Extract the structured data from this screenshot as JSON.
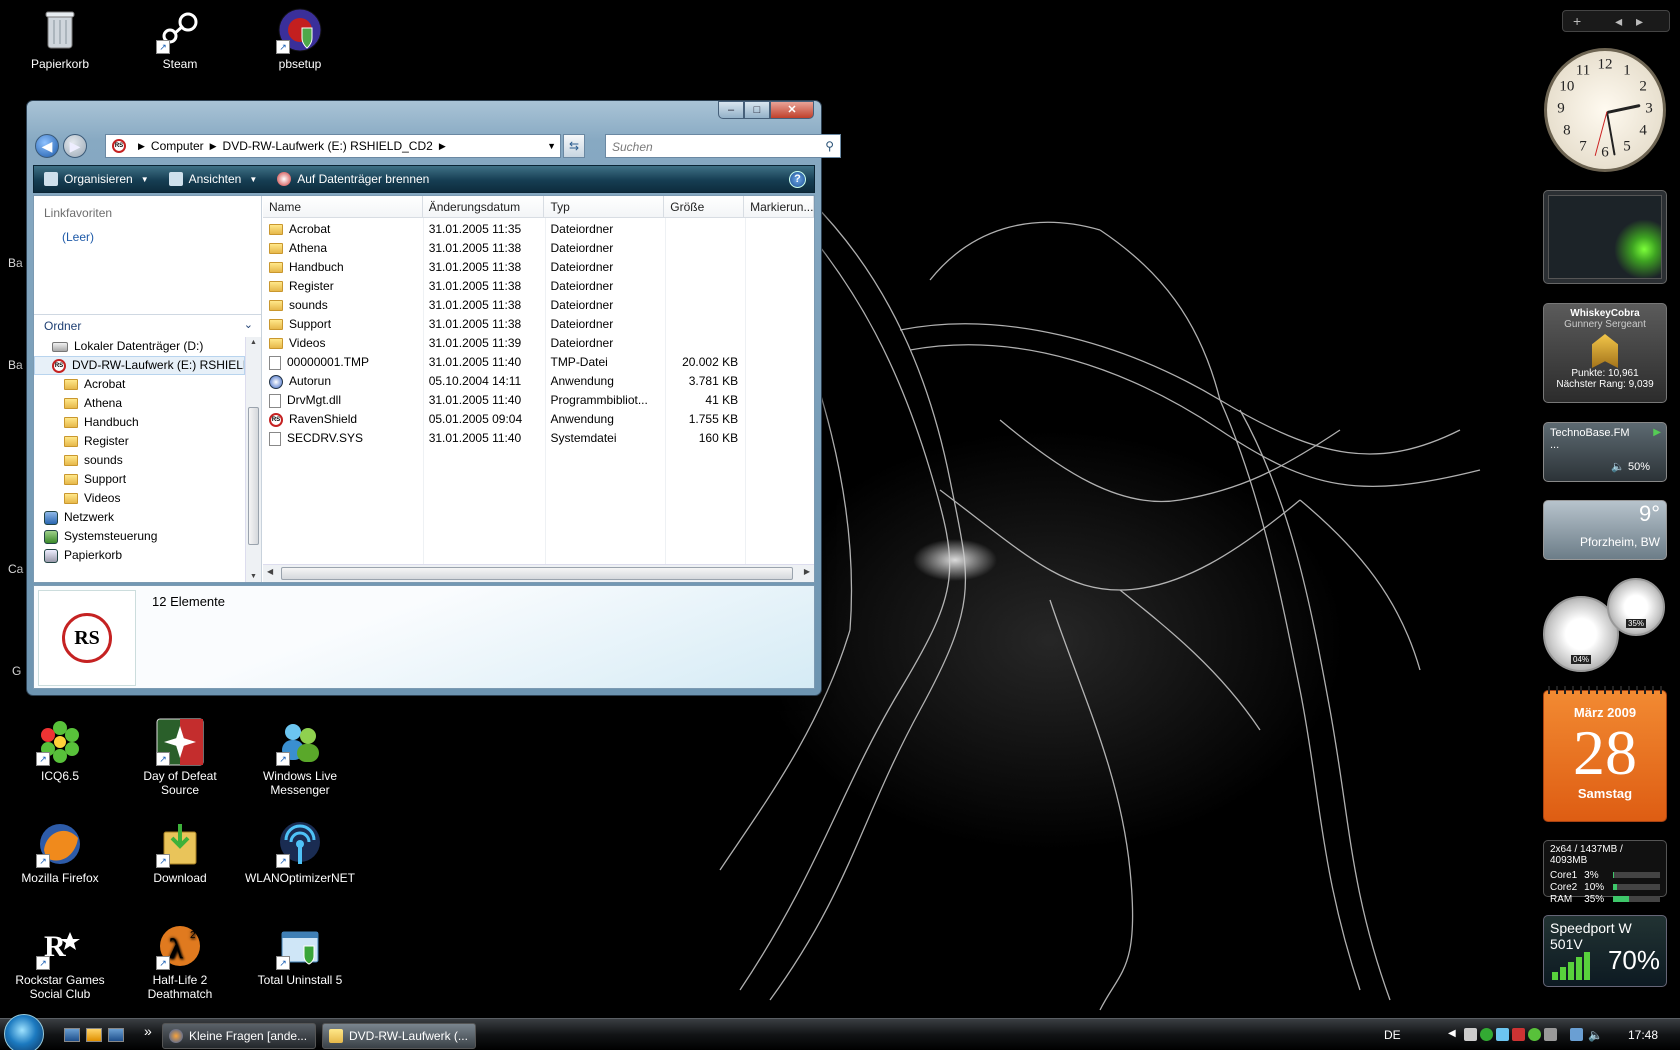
{
  "desktop": {
    "icons_top": [
      {
        "label": "Papierkorb",
        "icon": "recycle-bin-icon"
      },
      {
        "label": "Steam",
        "icon": "steam-icon"
      },
      {
        "label": "pbsetup",
        "icon": "pbsetup-icon"
      }
    ],
    "left_edge_fragments": [
      "Ba",
      "Ba",
      "Ca",
      "G"
    ],
    "icons_bottom": [
      {
        "label": "ICQ6.5",
        "icon": "icq-icon"
      },
      {
        "label": "Day of Defeat Source",
        "icon": "day-of-defeat-icon"
      },
      {
        "label": "Windows Live Messenger",
        "icon": "messenger-icon"
      },
      {
        "label": "Mozilla Firefox",
        "icon": "firefox-icon"
      },
      {
        "label": "Download",
        "icon": "download-folder-icon"
      },
      {
        "label": "WLANOptimizerNET",
        "icon": "wlan-optimizer-icon"
      },
      {
        "label": "Rockstar Games Social Club",
        "icon": "rockstar-icon"
      },
      {
        "label": "Half-Life 2 Deathmatch",
        "icon": "half-life-icon"
      },
      {
        "label": "Total Uninstall 5",
        "icon": "uninstall-icon"
      }
    ]
  },
  "explorer": {
    "caption_buttons": {
      "minimize": "–",
      "maximize": "□",
      "close": "✕"
    },
    "breadcrumb": [
      "Computer",
      "DVD-RW-Laufwerk (E:) RSHIELD_CD2"
    ],
    "search_placeholder": "Suchen",
    "toolbar": {
      "organize": "Organisieren",
      "views": "Ansichten",
      "burn": "Auf Datenträger brennen"
    },
    "nav": {
      "favorites_title": "Linkfavoriten",
      "favorites_empty": "(Leer)",
      "folders_title": "Ordner",
      "tree": [
        {
          "label": "Lokaler Datenträger (D:)",
          "icon": "drive-icon",
          "level": 1
        },
        {
          "label": "DVD-RW-Laufwerk (E:) RSHIELD_CD2",
          "icon": "dvd-drive-icon",
          "level": 1,
          "selected": true
        },
        {
          "label": "Acrobat",
          "icon": "folder-icon",
          "level": 2
        },
        {
          "label": "Athena",
          "icon": "folder-icon",
          "level": 2
        },
        {
          "label": "Handbuch",
          "icon": "folder-icon",
          "level": 2
        },
        {
          "label": "Register",
          "icon": "folder-icon",
          "level": 2
        },
        {
          "label": "sounds",
          "icon": "folder-icon",
          "level": 2
        },
        {
          "label": "Support",
          "icon": "folder-icon",
          "level": 2
        },
        {
          "label": "Videos",
          "icon": "folder-icon",
          "level": 2
        },
        {
          "label": "Netzwerk",
          "icon": "network-icon",
          "level": 0
        },
        {
          "label": "Systemsteuerung",
          "icon": "control-panel-icon",
          "level": 0
        },
        {
          "label": "Papierkorb",
          "icon": "recycle-bin-icon",
          "level": 0
        }
      ]
    },
    "columns": [
      "Name",
      "Änderungsdatum",
      "Typ",
      "Größe",
      "Markierun..."
    ],
    "files": [
      {
        "name": "Acrobat",
        "date": "31.01.2005 11:35",
        "type": "Dateiordner",
        "size": "",
        "icon": "folder-icon"
      },
      {
        "name": "Athena",
        "date": "31.01.2005 11:38",
        "type": "Dateiordner",
        "size": "",
        "icon": "folder-icon"
      },
      {
        "name": "Handbuch",
        "date": "31.01.2005 11:38",
        "type": "Dateiordner",
        "size": "",
        "icon": "folder-icon"
      },
      {
        "name": "Register",
        "date": "31.01.2005 11:38",
        "type": "Dateiordner",
        "size": "",
        "icon": "folder-icon"
      },
      {
        "name": "sounds",
        "date": "31.01.2005 11:38",
        "type": "Dateiordner",
        "size": "",
        "icon": "folder-icon"
      },
      {
        "name": "Support",
        "date": "31.01.2005 11:38",
        "type": "Dateiordner",
        "size": "",
        "icon": "folder-icon"
      },
      {
        "name": "Videos",
        "date": "31.01.2005 11:39",
        "type": "Dateiordner",
        "size": "",
        "icon": "folder-icon"
      },
      {
        "name": "00000001.TMP",
        "date": "31.01.2005 11:40",
        "type": "TMP-Datei",
        "size": "20.002 KB",
        "icon": "file-icon"
      },
      {
        "name": "Autorun",
        "date": "05.10.2004 14:11",
        "type": "Anwendung",
        "size": "3.781 KB",
        "icon": "app-icon"
      },
      {
        "name": "DrvMgt.dll",
        "date": "31.01.2005 11:40",
        "type": "Programmbibliot...",
        "size": "41 KB",
        "icon": "dll-icon"
      },
      {
        "name": "RavenShield",
        "date": "05.01.2005 09:04",
        "type": "Anwendung",
        "size": "1.755 KB",
        "icon": "ravenshield-icon"
      },
      {
        "name": "SECDRV.SYS",
        "date": "31.01.2005 11:40",
        "type": "Systemdatei",
        "size": "160 KB",
        "icon": "sys-file-icon"
      }
    ],
    "details": {
      "count": "12 Elemente",
      "logo_text": "RS"
    }
  },
  "gadgets": {
    "sidebar_controls": {
      "add": "+",
      "prev": "◂",
      "next": "▸"
    },
    "clock": {
      "numerals": [
        "12",
        "1",
        "2",
        "3",
        "4",
        "5",
        "6",
        "7",
        "8",
        "9",
        "10",
        "11"
      ]
    },
    "rank": {
      "name": "WhiskeyCobra",
      "rank": "Gunnery Sergeant",
      "points": "Punkte: 10,961",
      "next": "Nächster Rang: 9,039"
    },
    "radio": {
      "station": "TechnoBase.FM",
      "status": "...",
      "volume": "50%"
    },
    "weather": {
      "temp": "9°",
      "city": "Pforzheim, BW"
    },
    "meters": {
      "cpu": "04%",
      "ram": "35%"
    },
    "calendar": {
      "month": "März 2009",
      "day": "28",
      "weekday": "Samstag"
    },
    "sysmon": {
      "header": "2x64 / 1437MB / 4093MB",
      "rows": [
        {
          "label": "Core1",
          "value": "3%",
          "level": 0.03
        },
        {
          "label": "Core2",
          "value": "10%",
          "level": 0.1
        },
        {
          "label": "RAM",
          "value": "35%",
          "level": 0.35
        }
      ]
    },
    "wifi": {
      "name": "Speedport W 501V",
      "signal": "70%",
      "level": 0.7
    }
  },
  "taskbar": {
    "buttons": [
      {
        "label": "Kleine Fragen [ande...",
        "icon": "firefox-icon"
      },
      {
        "label": "DVD-RW-Laufwerk (...",
        "icon": "folder-icon",
        "active": true
      }
    ],
    "quick_more": "»",
    "language": "DE",
    "time": "17:48"
  }
}
